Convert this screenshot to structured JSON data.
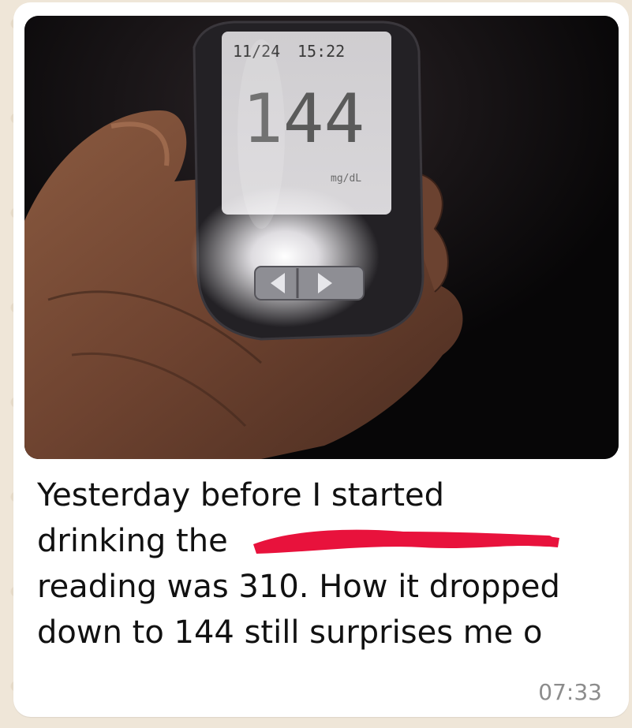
{
  "message": {
    "lines": [
      "Yesterday before I started",
      "drinking the",
      "reading was 310. How it dropped",
      "down to 144 still surprises me o"
    ],
    "timestamp": "07:33"
  },
  "photo": {
    "meter_date": "11/24",
    "meter_time": "15:22",
    "meter_reading": "144",
    "meter_unit": "mg/dL"
  },
  "colors": {
    "bubble": "#ffffff",
    "background": "#efe6d8",
    "redaction": "#e8123c",
    "timestamp": "#8c8c8c"
  },
  "icons": [
    "glucometer-photo",
    "redaction-scribble"
  ]
}
